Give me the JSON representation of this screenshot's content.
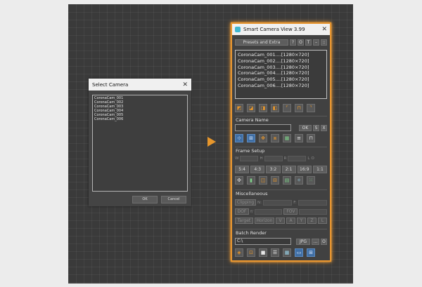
{
  "select_dialog": {
    "title": "Select Camera",
    "items": [
      "CoronaCam_001",
      "CoronaCam_002",
      "CoronaCam_003",
      "CoronaCam_004",
      "CoronaCam_005",
      "CoronaCam_006"
    ],
    "ok_label": "OK",
    "cancel_label": "Cancel"
  },
  "panel": {
    "title": "Smart Camera View 3.99",
    "presets_label": "Presets and Extra",
    "top_buttons": [
      "?",
      "O",
      "T",
      "–",
      "::"
    ],
    "cameras": [
      "CoronaCam_001....[1280×720]",
      "CoronaCam_002....[1280×720]",
      "CoronaCam_003....[1280×720]",
      "CoronaCam_004....[1280×720]",
      "CoronaCam_005....[1280×720]",
      "CoronaCam_006....[1280×720]"
    ],
    "camera_name": {
      "heading": "Camera Name",
      "value": "",
      "ok_label": "OK",
      "s_label": "S",
      "x_label": "X"
    },
    "frame_setup": {
      "heading": "Frame Setup",
      "w_label": "W",
      "h_label": "H",
      "r_label": "R",
      "l_label": "L",
      "o_label": "O",
      "ratios": [
        "5:4",
        "4:3",
        "3:2",
        "2:1",
        "16:9",
        "1:1"
      ]
    },
    "misc": {
      "heading": "Miscellaneous",
      "clipping_label": "Clipping",
      "n_label": "N:",
      "f_label": "F:",
      "dof_label": "DOF",
      "fstop_label": "f/",
      "fov_label": "FOV",
      "target_label": "Target",
      "horizon_label": "Horizon",
      "axes": [
        "V",
        "A",
        "Y",
        "Z",
        "L"
      ]
    },
    "batch": {
      "heading": "Batch Render",
      "path": "C:\\",
      "format_label": "JPG",
      "more_label": "...",
      "open_label": "O"
    },
    "icons": {
      "view_row": [
        "view-top-icon",
        "view-front-icon",
        "view-side-icon",
        "view-back-icon",
        "view-left-icon",
        "view-bottom-icon",
        "view-right-icon"
      ],
      "camera_row": [
        "target-icon",
        "frame-icon",
        "move-icon",
        "fit-icon",
        "grid-icon",
        "align-icon",
        "level-icon"
      ],
      "frame_row": [
        "safe-frame-icon",
        "bars-icon",
        "crop-icon",
        "region-icon",
        "grid-view-icon",
        "aspect-icon",
        "dots-icon"
      ],
      "batch_row": [
        "render-icon",
        "render-sel-icon",
        "stop-icon",
        "list-icon",
        "queue-icon",
        "window-icon",
        "overlay-icon"
      ]
    },
    "accent_color": "#e89630"
  }
}
